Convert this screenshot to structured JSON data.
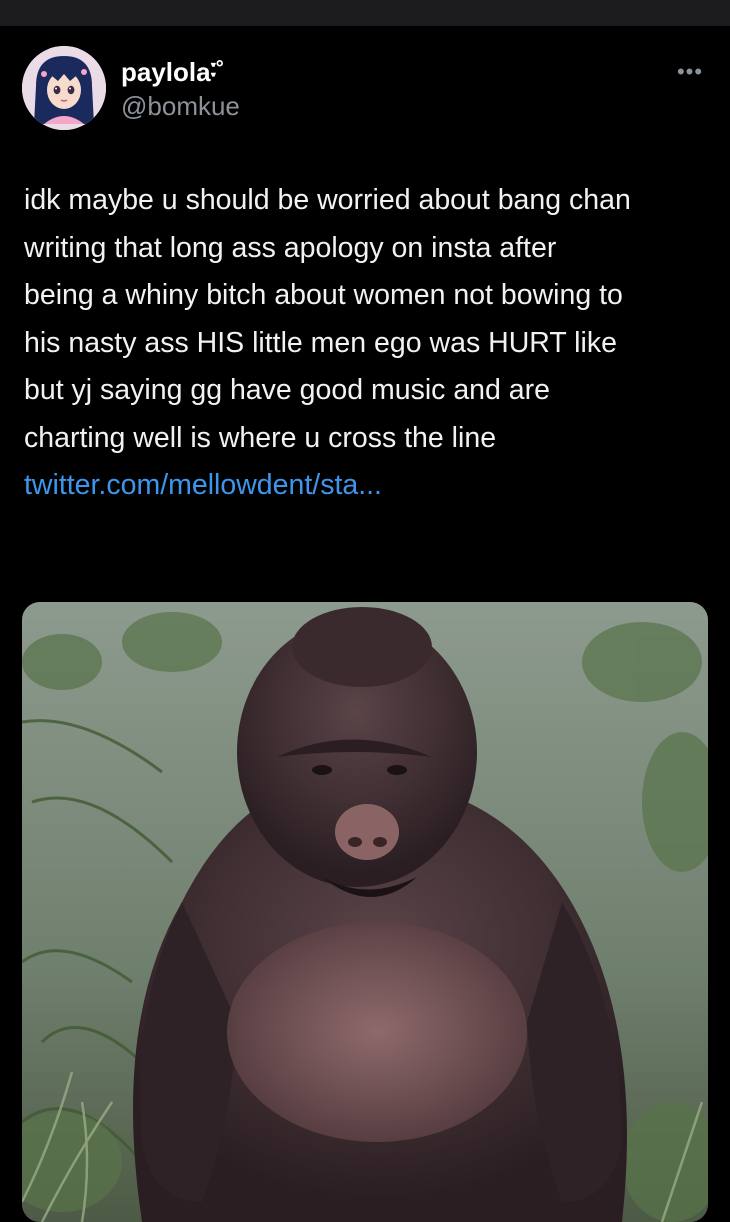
{
  "tweet": {
    "author": {
      "display_name": "paylola࿒˚",
      "handle": "@bomkue"
    },
    "more_icon": "more-horizontal-icon",
    "text_lines": [
      "idk maybe u should be worried about bang chan",
      "writing that long ass apology on insta after",
      "being a whiny bitch about women not bowing to",
      "his nasty ass HIS little men ego was HURT like",
      "but yj saying gg have good music and are",
      "charting well is where u cross the line"
    ],
    "link_text": "twitter.com/mellowdent/sta...",
    "colors": {
      "background": "#000000",
      "text": "#f2f2f2",
      "secondary": "#8b9299",
      "link": "#3d96ec"
    }
  }
}
